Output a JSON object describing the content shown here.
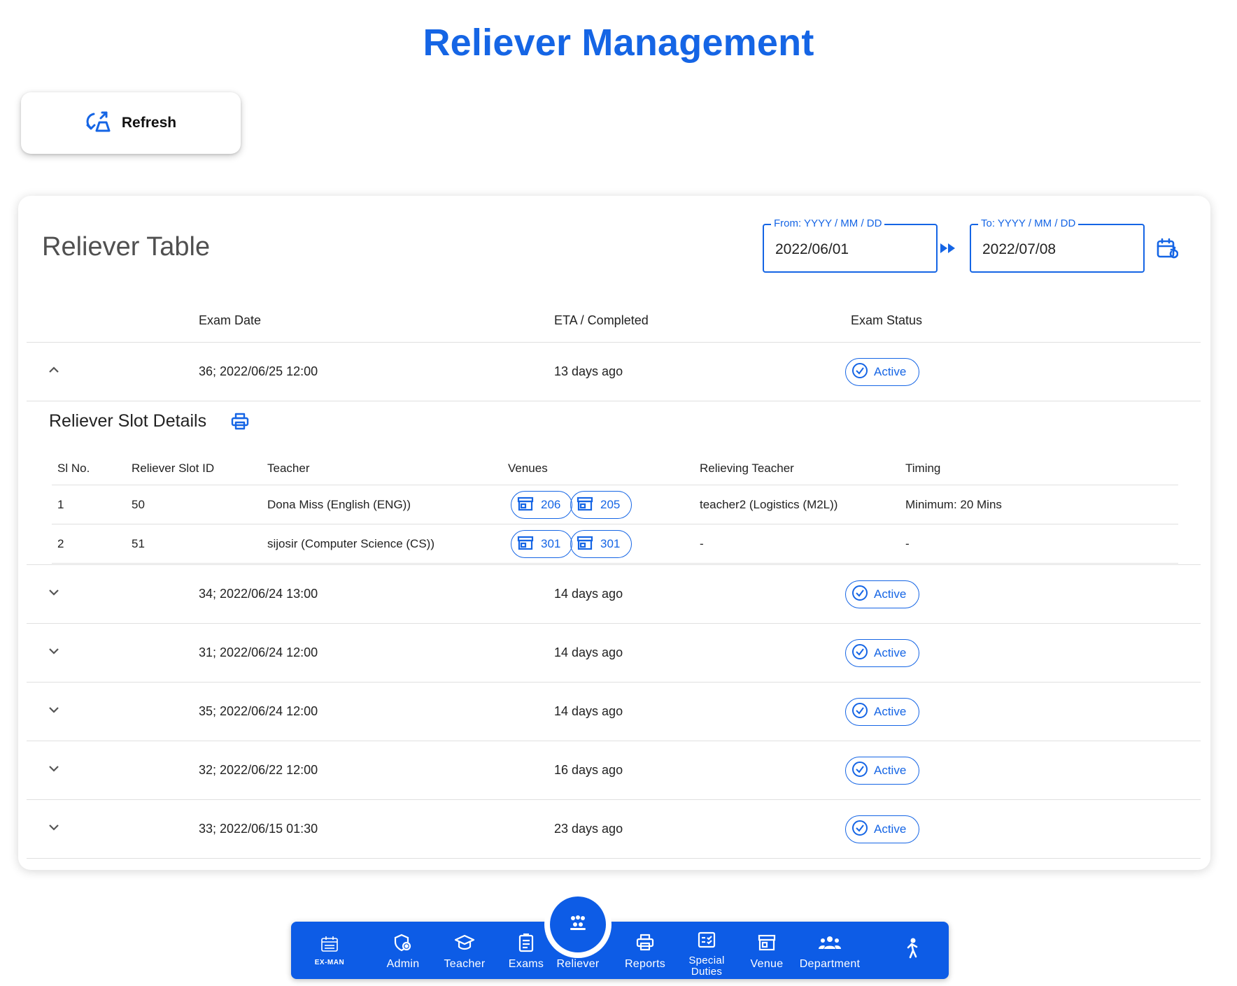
{
  "page": {
    "title": "Reliever Management"
  },
  "refresh": {
    "label": "Refresh",
    "icon": "refresh-icon"
  },
  "card": {
    "title": "Reliever Table",
    "from": {
      "legend": "From: YYYY / MM / DD",
      "value": "2022/06/01"
    },
    "to": {
      "legend": "To: YYYY / MM / DD",
      "value": "2022/07/08"
    }
  },
  "table": {
    "headers": {
      "exam_date": "Exam Date",
      "eta": "ETA / Completed",
      "status": "Exam Status"
    },
    "rows": [
      {
        "exam": "36; 2022/06/25 12:00",
        "eta": "13 days ago",
        "status": "Active",
        "expanded": true
      },
      {
        "exam": "34; 2022/06/24 13:00",
        "eta": "14 days ago",
        "status": "Active",
        "expanded": false
      },
      {
        "exam": "31; 2022/06/24 12:00",
        "eta": "14 days ago",
        "status": "Active",
        "expanded": false
      },
      {
        "exam": "35; 2022/06/24 12:00",
        "eta": "14 days ago",
        "status": "Active",
        "expanded": false
      },
      {
        "exam": "32; 2022/06/22 12:00",
        "eta": "16 days ago",
        "status": "Active",
        "expanded": false
      },
      {
        "exam": "33; 2022/06/15 01:30",
        "eta": "23 days ago",
        "status": "Active",
        "expanded": false
      }
    ]
  },
  "details": {
    "title": "Reliever Slot Details",
    "headers": {
      "sl": "Sl No.",
      "slot": "Reliever Slot ID",
      "teacher": "Teacher",
      "venues": "Venues",
      "relieving": "Relieving Teacher",
      "timing": "Timing"
    },
    "rows": [
      {
        "sl": "1",
        "slot": "50",
        "teacher": "Dona Miss (English (ENG))",
        "venues": [
          "206",
          "205"
        ],
        "relieving": "teacher2 (Logistics (M2L))",
        "timing": "Minimum: 20 Mins"
      },
      {
        "sl": "2",
        "slot": "51",
        "teacher": "sijosir (Computer Science (CS))",
        "venues": [
          "301",
          "301"
        ],
        "relieving": "-",
        "timing": "-"
      }
    ]
  },
  "nav": {
    "logo": "EX-MAN",
    "items": {
      "admin": "Admin",
      "teacher": "Teacher",
      "exams": "Exams",
      "reliever": "Reliever",
      "reports": "Reports",
      "special": "Special Duties",
      "venue": "Venue",
      "department": "Department"
    }
  },
  "colors": {
    "accent": "#1565e5",
    "nav_bg": "#0d5ce6"
  }
}
